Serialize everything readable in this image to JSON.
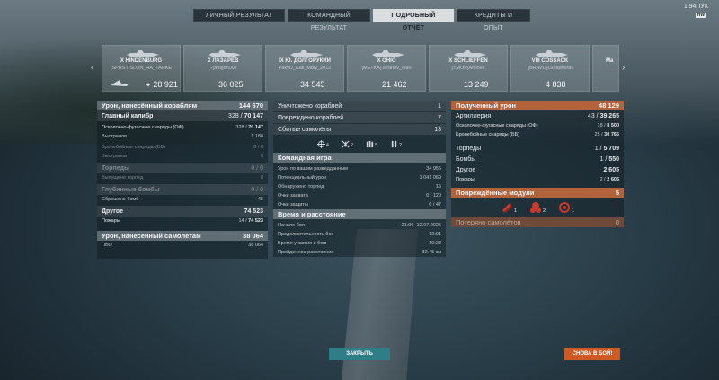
{
  "tabs": [
    "ЛИЧНЫЙ РЕЗУЛЬТАТ",
    "КОМАНДНЫЙ РЕЗУЛЬТАТ",
    "ПОДРОБНЫЙ ОТЧЁТ",
    "КРЕДИТЫ И ОПЫТ"
  ],
  "active_tab": "ПОДРОБНЫЙ ОТЧЁТ",
  "topright": {
    "version": "1.94ПУК",
    "hw_badge": "HW"
  },
  "ships": [
    {
      "name": "X HINDENBURG",
      "player": "[SPRST]SLON_HA_TAHKE",
      "damage": "28 921"
    },
    {
      "name": "X ЛАЗАРЕВ",
      "player": "[?]anigon007",
      "damage": "36 025"
    },
    {
      "name": "IX Ю. ДОЛГОРУКИЙ",
      "player": "PakyD_Kak_Mbly_2012",
      "damage": "34 545"
    },
    {
      "name": "X OHIO",
      "player": "[METKA]Taranov_Ivan",
      "damage": "21 462"
    },
    {
      "name": "X SCHLIEFFEN",
      "player": "[TMOP]Anilove",
      "damage": "13 249"
    },
    {
      "name": "VIII COSSACK",
      "player": "[BRAVO]Lunadmiral",
      "damage": "4 838"
    },
    {
      "name": "Ma",
      "player": "",
      "damage": ""
    }
  ],
  "left": {
    "h1": {
      "label": "Урон, нанесённый кораблям",
      "value": "144 670"
    },
    "main_caliber": {
      "label": "Главный калибр",
      "value_a": "328",
      "value_b": "70 147"
    },
    "he_shells": {
      "label": "Осколочно-фугасные снаряды (ОФ)",
      "value_a": "328",
      "value_b": "70 147"
    },
    "shots": {
      "label": "Выстрелов",
      "value": "1 188"
    },
    "ap_shells": {
      "label": "Бронебойные снаряды (ББ)",
      "value": "0 / 0"
    },
    "ap_shots": {
      "label": "Выстрелов",
      "value": "0"
    },
    "torpedoes": {
      "label": "Торпеды",
      "value": "0 / 0"
    },
    "torp_fired": {
      "label": "Выпущено торпед",
      "value": "0"
    },
    "depth_charges": {
      "label": "Глубинные бомбы",
      "value": "0 / 0"
    },
    "bombs_dropped": {
      "label": "Сброшено бомб",
      "value": "48"
    },
    "other": {
      "label": "Другое",
      "value": "74 523"
    },
    "fires": {
      "label": "Пожары",
      "value_a": "14",
      "value_b": "74 523"
    },
    "h2": {
      "label": "Урон, нанесённый самолётам",
      "value": "38 064"
    },
    "aa": {
      "label": "ПВО",
      "value": "38 064"
    }
  },
  "mid": {
    "destroyed": {
      "label": "Уничтожено кораблей",
      "value": "1"
    },
    "damaged": {
      "label": "Повреждено кораблей",
      "value": "7"
    },
    "planes": {
      "label": "Сбитые самолёты",
      "value": "13"
    },
    "icons": [
      {
        "name": "fighter-icon",
        "count": "4"
      },
      {
        "name": "bomber-icon",
        "count": "2"
      },
      {
        "name": "torpedo-bomber-icon",
        "count": "5"
      },
      {
        "name": "attack-aircraft-icon",
        "count": "2"
      }
    ],
    "team_header": "Командная игра",
    "spotting_damage": {
      "label": "Урон по вашим разведданным",
      "value": "34 956"
    },
    "potential_damage": {
      "label": "Потенциальный урон",
      "value": "1 041 069"
    },
    "torps_spotted": {
      "label": "Обнаружено торпед",
      "value": "15"
    },
    "capture": {
      "label": "Очки захвата",
      "value": "0 / 120"
    },
    "defense": {
      "label": "Очки защиты",
      "value": "6 / 47"
    },
    "time_header": "Время и расстояние",
    "start": {
      "label": "Начало боя",
      "time": "21:06",
      "date": "12.07.2025"
    },
    "duration": {
      "label": "Продолжительность боя",
      "value": "12:01"
    },
    "participation": {
      "label": "Время участия в бою",
      "value": "10:28"
    },
    "distance": {
      "label": "Пройденное расстояние",
      "value": "32.45 км"
    }
  },
  "right": {
    "h1": {
      "label": "Полученный урон",
      "value": "48 129"
    },
    "artillery": {
      "label": "Артиллерия",
      "value_a": "43",
      "value_b": "39 265"
    },
    "he": {
      "label": "Осколочно-фугасные снаряды (ОФ)",
      "value_a": "18",
      "value_b": "8 500"
    },
    "ap": {
      "label": "Бронебойные снаряды (ББ)",
      "value_a": "25",
      "value_b": "30 765"
    },
    "torpedoes": {
      "label": "Торпеды",
      "value_a": "1",
      "value_b": "5 709"
    },
    "bombs": {
      "label": "Бомбы",
      "value_a": "1",
      "value_b": "550"
    },
    "other": {
      "label": "Другое",
      "value": "2 605"
    },
    "fires": {
      "label": "Пожары",
      "value_a": "2",
      "value_b": "2 605"
    },
    "modules": {
      "label": "Повреждённые модули",
      "value": "5"
    },
    "module_icons": [
      {
        "name": "engine-icon",
        "count": "1"
      },
      {
        "name": "turret-icon",
        "count": "2"
      },
      {
        "name": "steering-icon",
        "count": "1"
      }
    ],
    "lost_planes": {
      "label": "Потеряно самолётов",
      "value": "0"
    }
  },
  "buttons": {
    "close": "ЗАКРЫТЬ",
    "battle": "СНОВА В БОЙ!"
  },
  "colors": {
    "accent_orange": "#b2633c",
    "close_teal": "#2f7d87",
    "battle_orange": "#cf5a24"
  }
}
